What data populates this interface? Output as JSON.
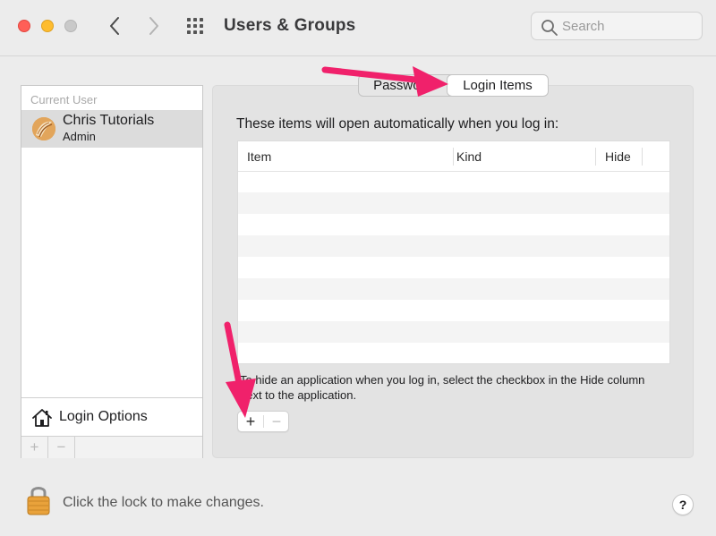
{
  "window": {
    "title": "Users & Groups",
    "search_placeholder": "Search"
  },
  "sidebar": {
    "section_label": "Current User",
    "users": [
      {
        "name": "Chris Tutorials",
        "role": "Admin"
      }
    ],
    "login_options_label": "Login Options",
    "add_symbol": "+",
    "remove_symbol": "−"
  },
  "tabs": [
    {
      "label": "Password",
      "selected": false
    },
    {
      "label": "Login Items",
      "selected": true
    }
  ],
  "login_items": {
    "description": "These items will open automatically when you log in:",
    "columns": [
      "Item",
      "Kind",
      "Hide"
    ],
    "rows": [],
    "hint": "To hide an application when you log in, select the checkbox in the Hide column next to the application.",
    "add_symbol": "+",
    "remove_symbol": "−"
  },
  "footer": {
    "lock_text": "Click the lock to make changes.",
    "help_symbol": "?"
  },
  "colors": {
    "annotation_arrow": "#f0216b",
    "close": "#ff5f57",
    "minimize": "#febc2e",
    "zoom_disabled": "#c9c9c9"
  },
  "icons": [
    "chevron-left-icon",
    "chevron-right-icon",
    "grid-icon",
    "search-icon",
    "avatar",
    "house-icon",
    "lock-icon"
  ]
}
